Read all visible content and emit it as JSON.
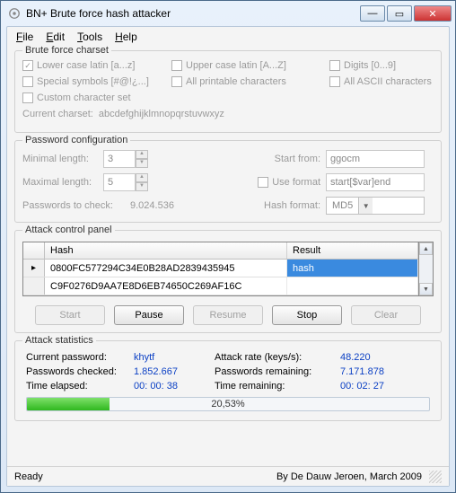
{
  "window": {
    "title": "BN+ Brute force hash attacker"
  },
  "menu": {
    "file": "File",
    "edit": "Edit",
    "tools": "Tools",
    "help": "Help"
  },
  "charset": {
    "legend": "Brute force charset",
    "lower": "Lower case latin [a...z]",
    "upper": "Upper case latin [A...Z]",
    "digits": "Digits [0...9]",
    "special": "Special symbols [#@!¿...]",
    "printable": "All printable characters",
    "ascii": "All ASCII characters",
    "custom": "Custom character set",
    "current_label": "Current charset:",
    "current_value": "abcdefghijklmnopqrstuvwxyz"
  },
  "pwcfg": {
    "legend": "Password configuration",
    "min_label": "Minimal length:",
    "min_value": "3",
    "max_label": "Maximal length:",
    "max_value": "5",
    "start_label": "Start from:",
    "start_value": "ggocm",
    "useformat_label": "Use format",
    "format_value": "start[$var]end",
    "tocheck_label": "Passwords to check:",
    "tocheck_value": "9.024.536",
    "hashformat_label": "Hash format:",
    "hashformat_value": "MD5"
  },
  "attack": {
    "legend": "Attack control panel",
    "col_hash": "Hash",
    "col_result": "Result",
    "rows": [
      {
        "hash": "0800FC577294C34E0B28AD2839435945",
        "result": "hash"
      },
      {
        "hash": "C9F0276D9AA7E8D6EB74650C269AF16C",
        "result": ""
      }
    ],
    "btn_start": "Start",
    "btn_pause": "Pause",
    "btn_resume": "Resume",
    "btn_stop": "Stop",
    "btn_clear": "Clear"
  },
  "stats": {
    "legend": "Attack statistics",
    "cur_label": "Current password:",
    "cur_value": "khytf",
    "rate_label": "Attack rate (keys/s):",
    "rate_value": "48.220",
    "checked_label": "Passwords checked:",
    "checked_value": "1.852.667",
    "remain_label": "Passwords remaining:",
    "remain_value": "7.171.878",
    "elapsed_label": "Time elapsed:",
    "elapsed_value": "00: 00: 38",
    "tremain_label": "Time remaining:",
    "tremain_value": "00: 02: 27",
    "progress_pct": "20,53%",
    "progress_width": "20.53%"
  },
  "status": {
    "ready": "Ready",
    "credit": "By De Dauw Jeroen, March 2009"
  }
}
